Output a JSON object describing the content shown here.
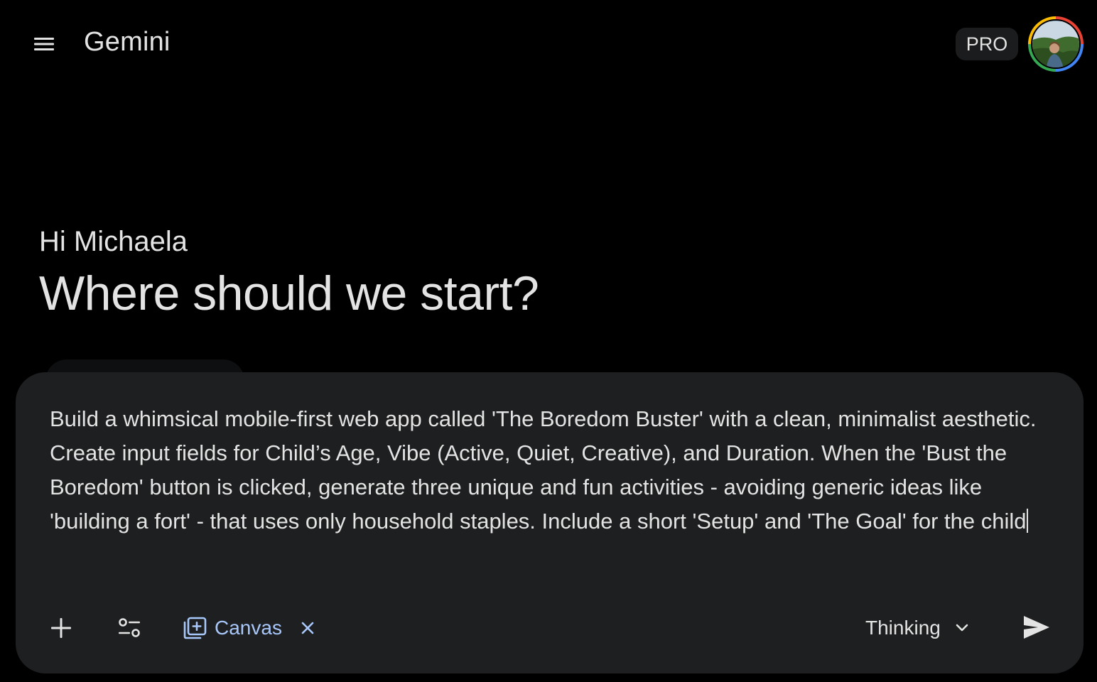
{
  "header": {
    "title": "Gemini",
    "menu_icon": "hamburger-menu-icon",
    "pro_badge": "PRO",
    "avatar_icon": "user-avatar"
  },
  "greeting": {
    "subtitle": "Hi Michaela",
    "headline": "Where should we start?"
  },
  "composer": {
    "prompt_value": "Build a whimsical mobile-first web app called 'The Boredom Buster' with a clean, minimalist aesthetic. Create input fields for Child’s Age, Vibe (Active, Quiet, Creative), and Duration. When the 'Bust the Boredom' button is clicked, generate three unique and fun activities - avoiding generic ideas like 'building a fort' - that uses only household staples. Include a short 'Setup' and 'The Goal' for the child",
    "add_icon": "plus-icon",
    "tools_icon": "tools-sliders-icon",
    "canvas_label": "Canvas",
    "canvas_icon": "canvas-add-icon",
    "canvas_remove_icon": "close-icon",
    "mode_label": "Thinking",
    "mode_icon": "chevron-down-icon",
    "send_icon": "send-icon"
  },
  "colors": {
    "background": "#000000",
    "composer_bg": "#1e1f20",
    "text": "#e3e3e3",
    "accent_blue": "#a8c7fa",
    "pro_badge_bg": "#1b1c1d"
  }
}
